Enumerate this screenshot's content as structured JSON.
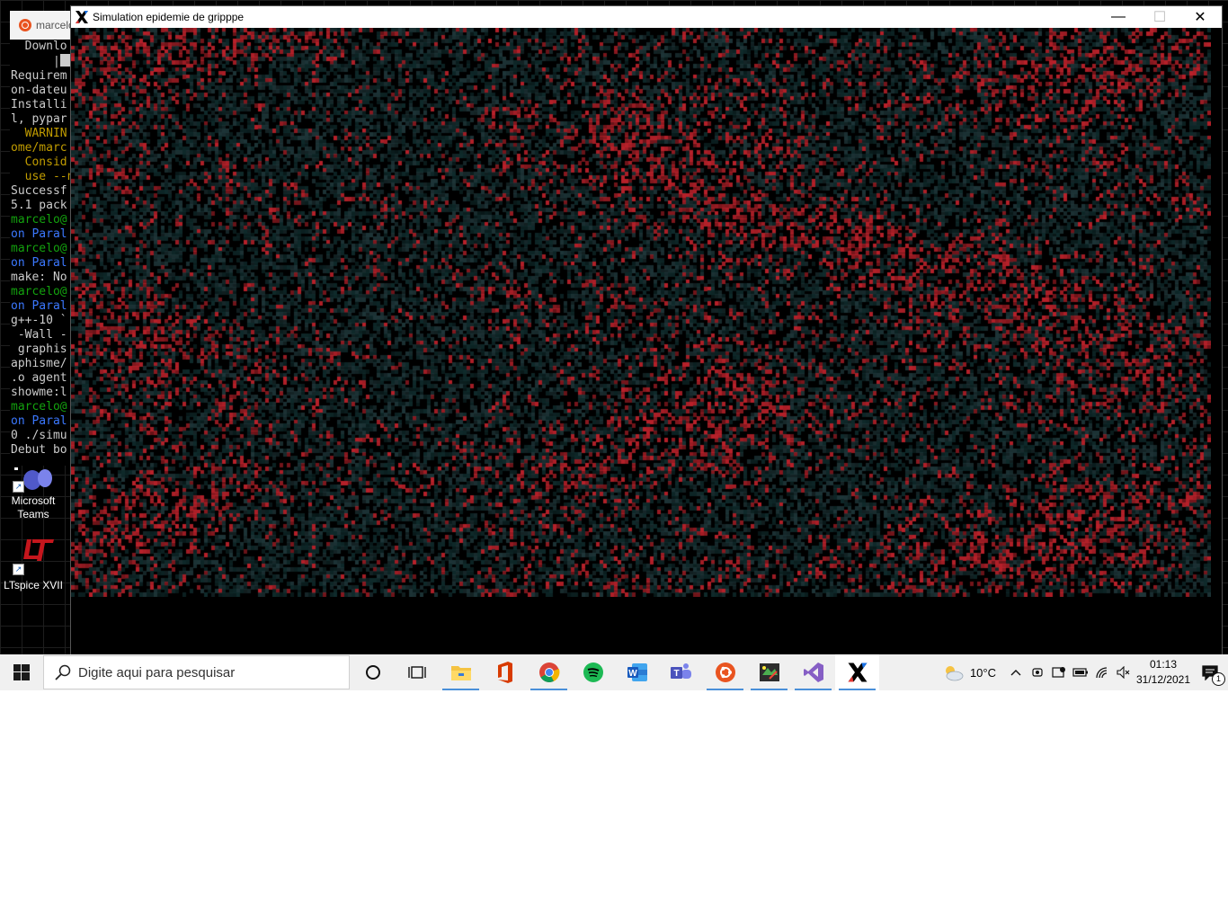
{
  "terminal": {
    "title": "marcelo",
    "lines": [
      {
        "text": "  Downlo",
        "color": "t-w"
      },
      {
        "text": "      |",
        "color": "t-w",
        "cursor": true
      },
      {
        "text": "Requirem",
        "color": "t-w"
      },
      {
        "text": "on-dateu",
        "color": "t-w"
      },
      {
        "text": "Installi",
        "color": "t-w"
      },
      {
        "text": "l, pypar",
        "color": "t-w"
      },
      {
        "text": "  WARNIN",
        "color": "t-y"
      },
      {
        "text": "ome/marc",
        "color": "t-y"
      },
      {
        "text": "  Consid",
        "color": "t-y"
      },
      {
        "text": "  use --n",
        "color": "t-y"
      },
      {
        "text": "Successf",
        "color": "t-w"
      },
      {
        "text": "5.1 pack",
        "color": "t-w"
      },
      {
        "text": "marcelo@",
        "color": "t-g"
      },
      {
        "text": "on Paral",
        "color": "t-b"
      },
      {
        "text": "marcelo@",
        "color": "t-g"
      },
      {
        "text": "on Paral",
        "color": "t-b"
      },
      {
        "text": "make: No",
        "color": "t-w"
      },
      {
        "text": "marcelo@",
        "color": "t-g"
      },
      {
        "text": "on Paral",
        "color": "t-b"
      },
      {
        "text": "g++-10 `",
        "color": "t-w"
      },
      {
        "text": " -Wall -",
        "color": "t-w"
      },
      {
        "text": " graphis",
        "color": "t-w"
      },
      {
        "text": "aphisme/",
        "color": "t-w"
      },
      {
        "text": ".o agent",
        "color": "t-w"
      },
      {
        "text": "showme:l",
        "color": "t-w"
      },
      {
        "text": "marcelo@",
        "color": "t-g"
      },
      {
        "text": "on Paral",
        "color": "t-b"
      },
      {
        "text": "0 ./simu",
        "color": "t-w"
      },
      {
        "text": "Debut bo",
        "color": "t-w"
      }
    ]
  },
  "desktop_icons": [
    {
      "label": "Microsoft Teams",
      "icon": "teams-icon"
    },
    {
      "label": "LTspice XVII",
      "icon": "ltspice-icon"
    }
  ],
  "sim_window": {
    "title": "Simulation epidemie de gripppe",
    "grid": {
      "cols": 317,
      "rows": 158
    },
    "colors": {
      "background": "#000000",
      "healthy": "#0f2a2b",
      "infected": "#b8212a",
      "recovered": "#1e3538"
    }
  },
  "window_controls": {
    "minimize": "—",
    "maximize": "☐",
    "close": "✕"
  },
  "taskbar": {
    "search_placeholder": "Digite aqui para pesquisar",
    "apps": [
      {
        "name": "cortana-button",
        "icon": "cortana-icon"
      },
      {
        "name": "task-view-button",
        "icon": "task-view-icon"
      },
      {
        "name": "file-explorer-button",
        "icon": "folder-icon"
      },
      {
        "name": "office-button",
        "icon": "office-icon"
      },
      {
        "name": "chrome-button",
        "icon": "chrome-icon"
      },
      {
        "name": "spotify-button",
        "icon": "spotify-icon"
      },
      {
        "name": "word-button",
        "icon": "word-icon"
      },
      {
        "name": "teams-button",
        "icon": "teams-icon"
      },
      {
        "name": "ubuntu-button",
        "icon": "ubuntu-icon"
      },
      {
        "name": "snip-button",
        "icon": "snip-icon"
      },
      {
        "name": "visual-studio-button",
        "icon": "visual-studio-icon"
      },
      {
        "name": "xserver-button",
        "icon": "x-icon"
      }
    ],
    "weather": "10°C",
    "time": "01:13",
    "date": "31/12/2021",
    "notification_count": "1"
  }
}
